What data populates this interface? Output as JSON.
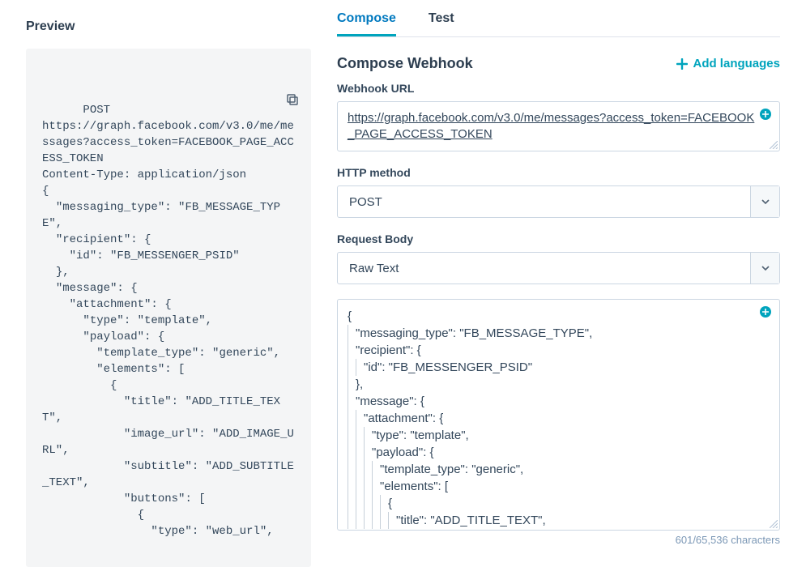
{
  "preview": {
    "title": "Preview",
    "code": "POST\nhttps://graph.facebook.com/v3.0/me/messages?access_token=FACEBOOK_PAGE_ACCESS_TOKEN\nContent-Type: application/json\n{\n  \"messaging_type\": \"FB_MESSAGE_TYPE\",\n  \"recipient\": {\n    \"id\": \"FB_MESSENGER_PSID\"\n  },\n  \"message\": {\n    \"attachment\": {\n      \"type\": \"template\",\n      \"payload\": {\n        \"template_type\": \"generic\",\n        \"elements\": [\n          {\n            \"title\": \"ADD_TITLE_TEXT\",\n            \"image_url\": \"ADD_IMAGE_URL\",\n            \"subtitle\": \"ADD_SUBTITLE_TEXT\",\n            \"buttons\": [\n              {\n                \"type\": \"web_url\","
  },
  "tabs": {
    "compose": "Compose",
    "test": "Test"
  },
  "compose": {
    "title": "Compose Webhook",
    "add_languages": "Add languages",
    "url_label": "Webhook URL",
    "url_value": "https://graph.facebook.com/v3.0/me/messages?access_token=FACEBOOK_PAGE_ACCESS_TOKEN",
    "method_label": "HTTP method",
    "method_value": "POST",
    "body_label": "Request Body",
    "body_type": "Raw Text",
    "body_lines": [
      {
        "indent": 0,
        "text": "{"
      },
      {
        "indent": 1,
        "text": "\"messaging_type\": \"FB_MESSAGE_TYPE\","
      },
      {
        "indent": 1,
        "text": "\"recipient\": {"
      },
      {
        "indent": 2,
        "text": "\"id\": \"FB_MESSENGER_PSID\""
      },
      {
        "indent": 1,
        "text": "},"
      },
      {
        "indent": 1,
        "text": "\"message\": {"
      },
      {
        "indent": 2,
        "text": "\"attachment\": {"
      },
      {
        "indent": 3,
        "text": "\"type\": \"template\","
      },
      {
        "indent": 3,
        "text": "\"payload\": {"
      },
      {
        "indent": 4,
        "text": "\"template_type\": \"generic\","
      },
      {
        "indent": 4,
        "text": "\"elements\": ["
      },
      {
        "indent": 5,
        "text": "{"
      },
      {
        "indent": 6,
        "text": "\"title\": \"ADD_TITLE_TEXT\","
      }
    ],
    "char_count": "601/65,536 characters"
  }
}
